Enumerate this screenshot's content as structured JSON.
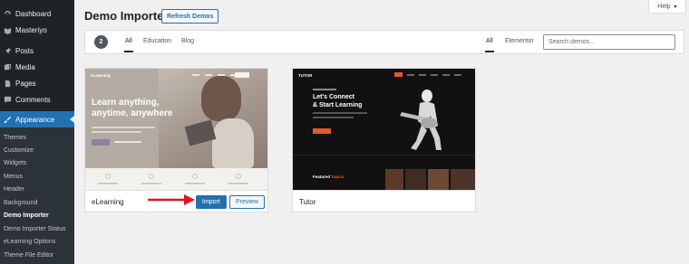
{
  "sidebar": {
    "menu": [
      {
        "label": "Dashboard",
        "icon": "dashboard-icon"
      },
      {
        "label": "Masteriyo",
        "icon": "masteriyo-icon"
      },
      {
        "label": "Posts",
        "icon": "pin-icon"
      },
      {
        "label": "Media",
        "icon": "media-icon"
      },
      {
        "label": "Pages",
        "icon": "pages-icon"
      },
      {
        "label": "Comments",
        "icon": "comments-icon"
      },
      {
        "label": "Appearance",
        "icon": "appearance-icon"
      }
    ],
    "submenu": [
      "Themes",
      "Customize",
      "Widgets",
      "Menus",
      "Header",
      "Background",
      "Demo Importer",
      "Demo Importer Status",
      "eLearning Options",
      "Theme File Editor"
    ],
    "current_submenu": "Demo Importer"
  },
  "header": {
    "title": "Demo Importer",
    "refresh_label": "Refresh Demos",
    "help_label": "Help"
  },
  "filters": {
    "count": "2",
    "categories": [
      "All",
      "Education",
      "Blog"
    ],
    "builders": [
      "All",
      "Elementor"
    ],
    "search_placeholder": "Search demos..."
  },
  "demos": [
    {
      "name": "eLearning",
      "thumb": {
        "logo": "eLearning",
        "headline": [
          "Learn anything,",
          "anytime, anywhere"
        ]
      },
      "import_label": "Import",
      "preview_label": "Preview"
    },
    {
      "name": "Tutor",
      "thumb": {
        "logo": "TUTOR",
        "headline": [
          "Let's Connect",
          "& Start Learning"
        ],
        "featured_prefix": "Featured ",
        "featured_highlight": "Topics"
      }
    }
  ],
  "colors": {
    "admin_bar": "#1d2327",
    "accent": "#2271b1",
    "arrow": "#e0121b",
    "tutor_accent": "#e05a2b"
  }
}
